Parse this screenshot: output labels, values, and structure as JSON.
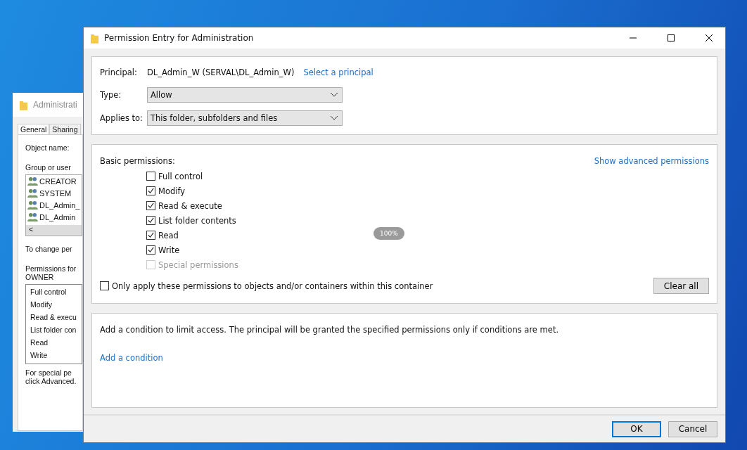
{
  "background_window": {
    "title": "Administrati",
    "tabs": [
      {
        "label": "General",
        "selected": true
      },
      {
        "label": "Sharing",
        "selected": false
      }
    ],
    "object_name_label": "Object name:",
    "group_label": "Group or user",
    "users": [
      "CREATOR",
      "SYSTEM",
      "DL_Admin_",
      "DL_Admin"
    ],
    "scroll_left": "<",
    "change_text": "To change per",
    "permissions_label": [
      "Permissions for",
      "OWNER"
    ],
    "permissions": [
      "Full control",
      "Modify",
      "Read & execu",
      "List folder con",
      "Read",
      "Write"
    ],
    "special_text": [
      "For special pe",
      "click Advanced."
    ]
  },
  "window": {
    "title": "Permission Entry for Administration",
    "principal_label": "Principal:",
    "principal": "DL_Admin_W (SERVAL\\DL_Admin_W)",
    "select_principal": "Select a principal",
    "type_label": "Type:",
    "type_value": "Allow",
    "applies_label": "Applies to:",
    "applies_value": "This folder, subfolders and files",
    "basic_label": "Basic permissions:",
    "advanced_link": "Show advanced permissions",
    "permissions": [
      {
        "label": "Full control",
        "checked": false,
        "disabled": false
      },
      {
        "label": "Modify",
        "checked": true,
        "disabled": false
      },
      {
        "label": "Read & execute",
        "checked": true,
        "disabled": false
      },
      {
        "label": "List folder contents",
        "checked": true,
        "disabled": false
      },
      {
        "label": "Read",
        "checked": true,
        "disabled": false
      },
      {
        "label": "Write",
        "checked": true,
        "disabled": false
      },
      {
        "label": "Special permissions",
        "checked": false,
        "disabled": true
      }
    ],
    "only_apply": {
      "label": "Only apply these permissions to objects and/or containers within this container",
      "checked": false
    },
    "clear_all": "Clear all",
    "condition_text": "Add a condition to limit access. The principal will be granted the specified permissions only if conditions are met.",
    "add_condition": "Add a condition",
    "buttons": [
      {
        "label": "OK",
        "selected": true
      },
      {
        "label": "Cancel",
        "selected": false
      }
    ]
  },
  "zoom_badge": "100%"
}
